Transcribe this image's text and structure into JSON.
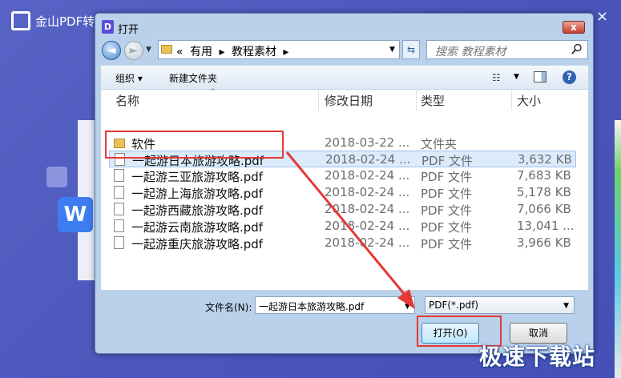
{
  "background_app": {
    "title": "金山PDF转",
    "close": "×",
    "icon": "wps-w-icon",
    "icon_letter": "W"
  },
  "dialog": {
    "title": "打开",
    "title_icon_letter": "D",
    "close_label": "x",
    "address": {
      "prefix": "«",
      "crumbs": [
        "有用",
        "教程素材"
      ],
      "separator": "▸"
    },
    "search_placeholder": "搜索 教程素材",
    "toolbar": {
      "organize": "组织 ▾",
      "new_folder": "新建文件夹"
    },
    "columns": {
      "name": "名称",
      "modified": "修改日期",
      "type": "类型",
      "size": "大小"
    },
    "files": [
      {
        "name": "软件",
        "modified": "2018-03-22 ...",
        "type": "文件夹",
        "size": "",
        "kind": "folder",
        "selected": false
      },
      {
        "name": "一起游日本旅游攻略.pdf",
        "modified": "2018-02-24 ...",
        "type": "PDF 文件",
        "size": "3,632 KB",
        "kind": "pdf",
        "selected": true
      },
      {
        "name": "一起游三亚旅游攻略.pdf",
        "modified": "2018-02-24 ...",
        "type": "PDF 文件",
        "size": "7,683 KB",
        "kind": "pdf",
        "selected": false
      },
      {
        "name": "一起游上海旅游攻略.pdf",
        "modified": "2018-02-24 ...",
        "type": "PDF 文件",
        "size": "5,178 KB",
        "kind": "pdf",
        "selected": false
      },
      {
        "name": "一起游西藏旅游攻略.pdf",
        "modified": "2018-02-24 ...",
        "type": "PDF 文件",
        "size": "7,066 KB",
        "kind": "pdf",
        "selected": false
      },
      {
        "name": "一起游云南旅游攻略.pdf",
        "modified": "2018-02-24 ...",
        "type": "PDF 文件",
        "size": "13,041 ...",
        "kind": "pdf",
        "selected": false
      },
      {
        "name": "一起游重庆旅游攻略.pdf",
        "modified": "2018-02-24 ...",
        "type": "PDF 文件",
        "size": "3,966 KB",
        "kind": "pdf",
        "selected": false
      }
    ],
    "filename_label": "文件名(N):",
    "filename_value": "一起游日本旅游攻略.pdf",
    "filetype_value": "PDF(*.pdf)",
    "open_button": "打开(O)",
    "cancel_button": "取消"
  },
  "annotation_color": "#e53935",
  "watermark": "极速下载站"
}
